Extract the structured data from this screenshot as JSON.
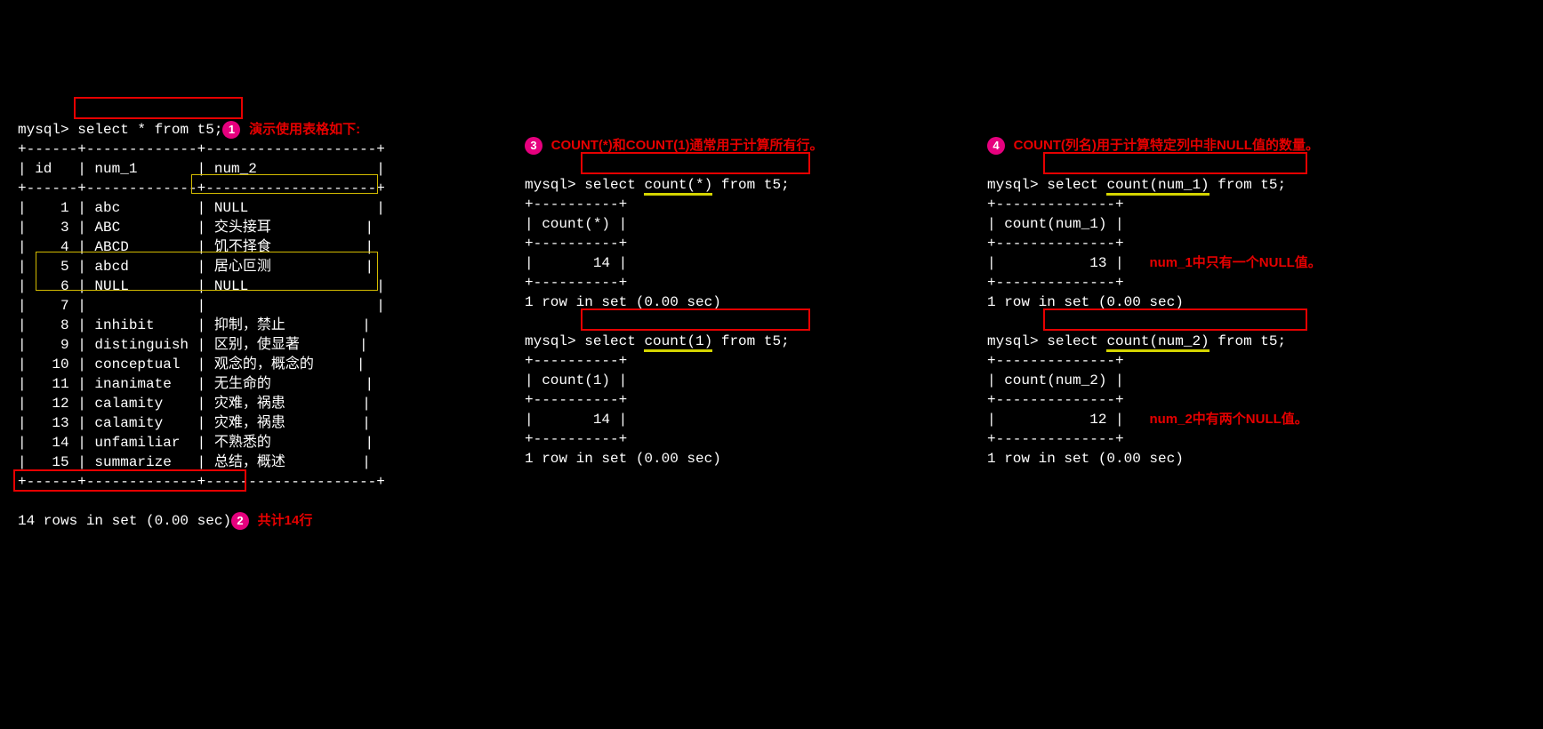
{
  "prompt": "mysql>",
  "col1": {
    "query": "select * from t5;",
    "note1": "演示使用表格如下:",
    "sep_top": "+------+-------------+--------------------+",
    "header": "| id   | num_1       | num_2              |",
    "sep_head": "+------+-------------+--------------------+",
    "rows": [
      "|    1 | abc         | NULL               |",
      "|    3 | ABC         | 交头接耳           |",
      "|    4 | ABCD        | 饥不择食           |",
      "|    5 | abcd        | 居心叵测           |",
      "|    6 | NULL        | NULL               |",
      "|    7 |             |                    |",
      "|    8 | inhibit     | 抑制，禁止         |",
      "|    9 | distinguish | 区别，使显著       |",
      "|   10 | conceptual  | 观念的，概念的     |",
      "|   11 | inanimate   | 无生命的           |",
      "|   12 | calamity    | 灾难，祸患         |",
      "|   13 | calamity    | 灾难，祸患         |",
      "|   14 | unfamiliar  | 不熟悉的           |",
      "|   15 | summarize   | 总结，概述         |"
    ],
    "sep_bot": "+------+-------------+--------------------+",
    "footer": "14 rows in set (0.00 sec)",
    "note2": "共计14行"
  },
  "col2": {
    "title_pre": "COUNT(*)",
    "title_mid": "和",
    "title_b": "COUNT(1)",
    "title_suf": "通常用于计算所有行。",
    "q1_pre": "select ",
    "q1_ul": "count(*)",
    "q1_post": " from t5;",
    "r1": [
      "+----------+",
      "| count(*) |",
      "+----------+",
      "|       14 |",
      "+----------+",
      "1 row in set (0.00 sec)"
    ],
    "q2_pre": "select ",
    "q2_ul": "count(1)",
    "q2_post": " from t5;",
    "r2": [
      "+----------+",
      "| count(1) |",
      "+----------+",
      "|       14 |",
      "+----------+",
      "1 row in set (0.00 sec)"
    ]
  },
  "col3": {
    "title_a": "COUNT(列名)",
    "title_b": "用于计算特定列中",
    "title_c": "非NULL值",
    "title_d": "的数量。",
    "q1_pre": "select ",
    "q1_ul": "count(num_1)",
    "q1_post": " from t5;",
    "r1": [
      "+--------------+",
      "| count(num_1) |",
      "+--------------+",
      "|           13 |",
      "+--------------+",
      "1 row in set (0.00 sec)"
    ],
    "note1": "num_1中只有一个NULL值。",
    "q2_pre": "select ",
    "q2_ul": "count(num_2)",
    "q2_post": " from t5;",
    "r2": [
      "+--------------+",
      "| count(num_2) |",
      "+--------------+",
      "|           12 |",
      "+--------------+",
      "1 row in set (0.00 sec)"
    ],
    "note2": "num_2中有两个NULL值。"
  },
  "badges": {
    "b1": "1",
    "b2": "2",
    "b3": "3",
    "b4": "4"
  }
}
